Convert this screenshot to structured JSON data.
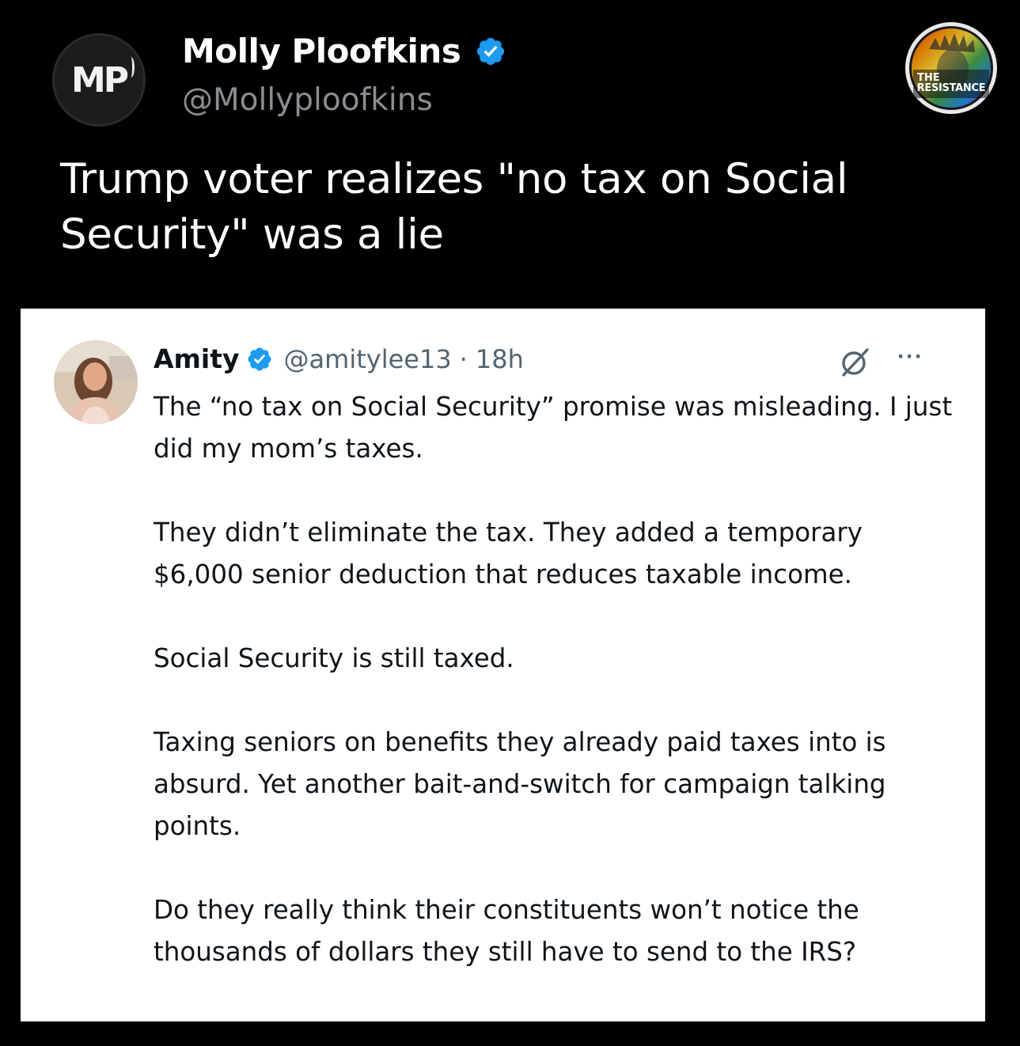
{
  "post": {
    "author_initials": "MP",
    "author_name": "Molly Ploofkins",
    "author_handle": "@Mollyploofkins",
    "text": "Trump voter realizes \"no tax on Social Security\" was a lie",
    "badge": {
      "line1": "THE",
      "line2": "RESISTANCE"
    }
  },
  "quoted_post": {
    "author_name": "Amity",
    "author_handle": "@amitylee13",
    "separator": "·",
    "time": "18h",
    "more_label": "···",
    "paragraphs": [
      "The “no tax on Social Security” promise was misleading. I just did my mom’s taxes.",
      "They didn’t eliminate the tax. They added a temporary $6,000 senior deduction that reduces taxable income.",
      "Social Security is still taxed.",
      "Taxing seniors on benefits they already paid taxes into is absurd. Yet another bait-and-switch for campaign talking points.",
      "Do they really think their constituents won’t notice the thousands of dollars they still have to send to the IRS?"
    ]
  },
  "colors": {
    "background": "#000000",
    "verified": "#1d9bf0",
    "secondary_text_dark": "#8a8d91",
    "secondary_text_light": "#536471",
    "card_background": "#ffffff"
  },
  "icons": {
    "verified": "verified-badge-icon",
    "grok": "grok-icon",
    "more": "more-options-icon"
  }
}
